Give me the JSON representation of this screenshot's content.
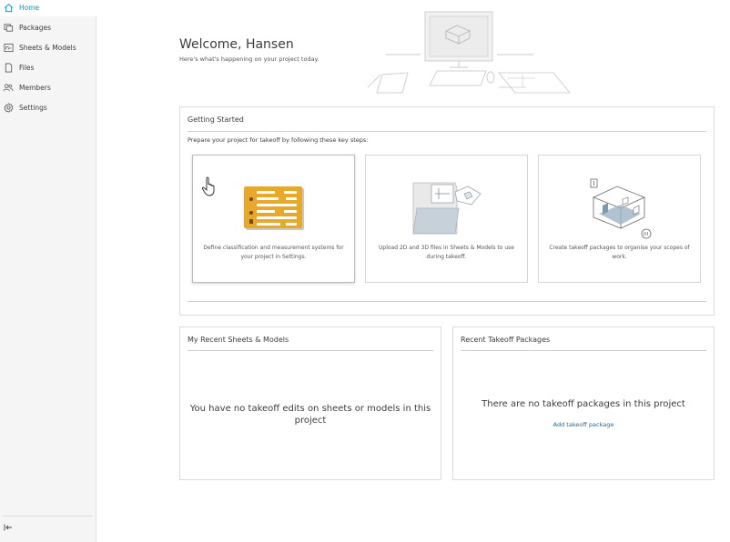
{
  "sidebar": {
    "items": [
      {
        "label": "Home",
        "icon": "home-icon",
        "active": true
      },
      {
        "label": "Packages",
        "icon": "packages-icon"
      },
      {
        "label": "Sheets & Models",
        "icon": "sheets-icon"
      },
      {
        "label": "Files",
        "icon": "file-icon"
      },
      {
        "label": "Members",
        "icon": "members-icon"
      },
      {
        "label": "Settings",
        "icon": "gear-icon"
      }
    ],
    "collapse_icon": "collapse-sidebar-icon"
  },
  "header": {
    "welcome": "Welcome, Hansen",
    "subtitle": "Here's what's happening on your project today."
  },
  "getting_started": {
    "title": "Getting Started",
    "description": "Prepare your project for takeoff by following these key steps:",
    "steps": [
      {
        "text": "Define classification and measurement systems for your project in Settings."
      },
      {
        "text": "Upload 2D and 3D files in Sheets & Models to use during takeoff."
      },
      {
        "text": "Create takeoff packages to organise your scopes of work."
      }
    ]
  },
  "recent_sheets": {
    "title": "My Recent Sheets & Models",
    "empty_message": "You have no takeoff edits on sheets or models in this project"
  },
  "recent_packages": {
    "title": "Recent Takeoff Packages",
    "empty_message": "There are no takeoff packages in this project",
    "add_link": "Add takeoff package"
  },
  "colors": {
    "accent": "#0696d7",
    "link": "#0a6fb5",
    "settings_card": "#e8a82a"
  }
}
